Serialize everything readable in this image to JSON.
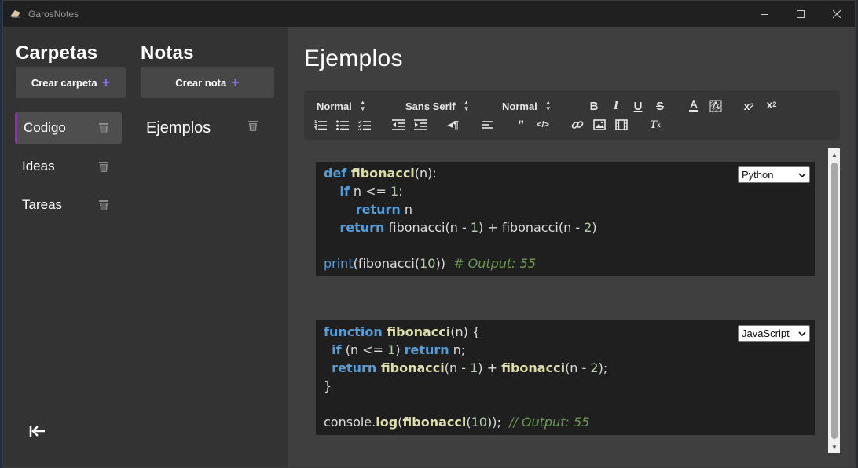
{
  "app": {
    "title": "GarosNotes"
  },
  "folders": {
    "heading": "Carpetas",
    "create_label": "Crear carpeta",
    "items": [
      {
        "label": "Codigo",
        "active": true
      },
      {
        "label": "Ideas",
        "active": false
      },
      {
        "label": "Tareas",
        "active": false
      }
    ]
  },
  "notes": {
    "heading": "Notas",
    "create_label": "Crear nota",
    "items": [
      {
        "label": "Ejemplos"
      }
    ]
  },
  "editor": {
    "title": "Ejemplos",
    "toolbar": {
      "header_select": "Normal",
      "font_select": "Sans Serif",
      "size_select": "Normal"
    },
    "blocks": [
      {
        "language": "Python",
        "lines": [
          [
            [
              "kw",
              "def "
            ],
            [
              "fn",
              "fibonacci"
            ],
            [
              "pl",
              "(n):"
            ]
          ],
          [
            [
              "pl",
              "    "
            ],
            [
              "kw",
              "if"
            ],
            [
              "pl",
              " n <= "
            ],
            [
              "num",
              "1"
            ],
            [
              "pl",
              ":"
            ]
          ],
          [
            [
              "pl",
              "        "
            ],
            [
              "kw",
              "return"
            ],
            [
              "pl",
              " n"
            ]
          ],
          [
            [
              "pl",
              "    "
            ],
            [
              "kw",
              "return"
            ],
            [
              "pl",
              " fibonacci(n - "
            ],
            [
              "num",
              "1"
            ],
            [
              "pl",
              ") + fibonacci(n - "
            ],
            [
              "num",
              "2"
            ],
            [
              "pl",
              ")"
            ]
          ],
          [],
          [
            [
              "bi",
              "print"
            ],
            [
              "pl",
              "(fibonacci("
            ],
            [
              "num",
              "10"
            ],
            [
              "pl",
              "))  "
            ],
            [
              "cm",
              "# Output: 55"
            ]
          ]
        ]
      },
      {
        "language": "JavaScript",
        "lines": [
          [
            [
              "kw",
              "function "
            ],
            [
              "fn",
              "fibonacci"
            ],
            [
              "pl",
              "(n) {"
            ]
          ],
          [
            [
              "pl",
              "  "
            ],
            [
              "kw",
              "if"
            ],
            [
              "pl",
              " (n <= "
            ],
            [
              "num",
              "1"
            ],
            [
              "pl",
              ") "
            ],
            [
              "kw",
              "return"
            ],
            [
              "pl",
              " n;"
            ]
          ],
          [
            [
              "pl",
              "  "
            ],
            [
              "kw",
              "return "
            ],
            [
              "fn",
              "fibonacci"
            ],
            [
              "pl",
              "(n - "
            ],
            [
              "num",
              "1"
            ],
            [
              "pl",
              ") + "
            ],
            [
              "fn",
              "fibonacci"
            ],
            [
              "pl",
              "(n - "
            ],
            [
              "num",
              "2"
            ],
            [
              "pl",
              ");"
            ]
          ],
          [
            [
              "pl",
              "}"
            ]
          ],
          [],
          [
            [
              "pl",
              "console."
            ],
            [
              "fn",
              "log"
            ],
            [
              "pl",
              "("
            ],
            [
              "fn",
              "fibonacci"
            ],
            [
              "pl",
              "("
            ],
            [
              "num",
              "10"
            ],
            [
              "pl",
              "));  "
            ],
            [
              "cm",
              "// Output: 55"
            ]
          ]
        ]
      }
    ]
  },
  "colors": {
    "accent": "#9b27c9",
    "plus": "#8a6ee6"
  }
}
